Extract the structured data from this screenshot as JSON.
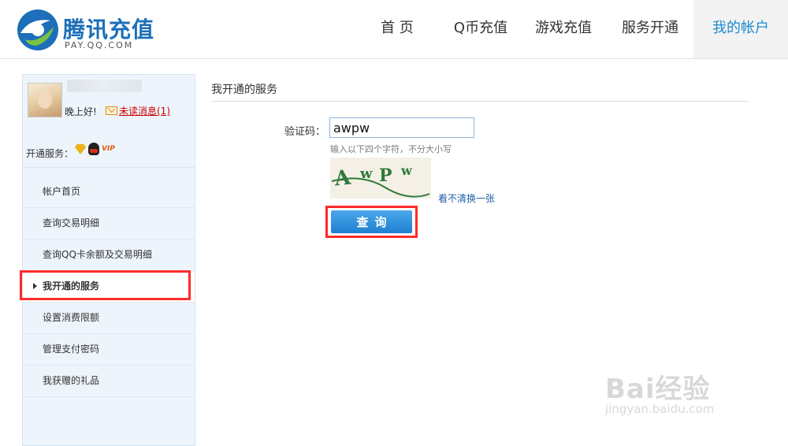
{
  "header": {
    "logo_title": "腾讯充值",
    "logo_subtitle": "PAY.QQ.COM",
    "nav": [
      {
        "label": "首 页"
      },
      {
        "label": "Q币充值"
      },
      {
        "label": "游戏充值"
      },
      {
        "label": "服务开通"
      },
      {
        "label": "我的帐户",
        "active": true
      }
    ]
  },
  "sidebar": {
    "greeting": "晚上好!",
    "unread_label": "未读消息(1)",
    "services_label": "开通服务：",
    "service_badge": "VIP",
    "menu": [
      {
        "label": "帐户首页"
      },
      {
        "label": "查询交易明细"
      },
      {
        "label": "查询QQ卡余额及交易明细"
      },
      {
        "label": "我开通的服务",
        "active": true
      },
      {
        "label": "设置消费限额"
      },
      {
        "label": "管理支付密码"
      },
      {
        "label": "我获赠的礼品"
      }
    ]
  },
  "main": {
    "title": "我开通的服务",
    "captcha_label": "验证码：",
    "captcha_value": "awpw",
    "hint": "输入以下四个字符，不分大小写",
    "refresh_label": "看不清换一张",
    "query_label": "查询"
  },
  "watermark": {
    "brand": "Bai经验",
    "url": "jingyan.baidu.com"
  },
  "colors": {
    "accent": "#1f8ad1",
    "highlight": "#ff2a2a",
    "sidebar_bg": "#edf4fb"
  },
  "icons": [
    "tencent-logo-icon",
    "mail-icon",
    "diamond-icon",
    "qq-penguin-icon"
  ]
}
